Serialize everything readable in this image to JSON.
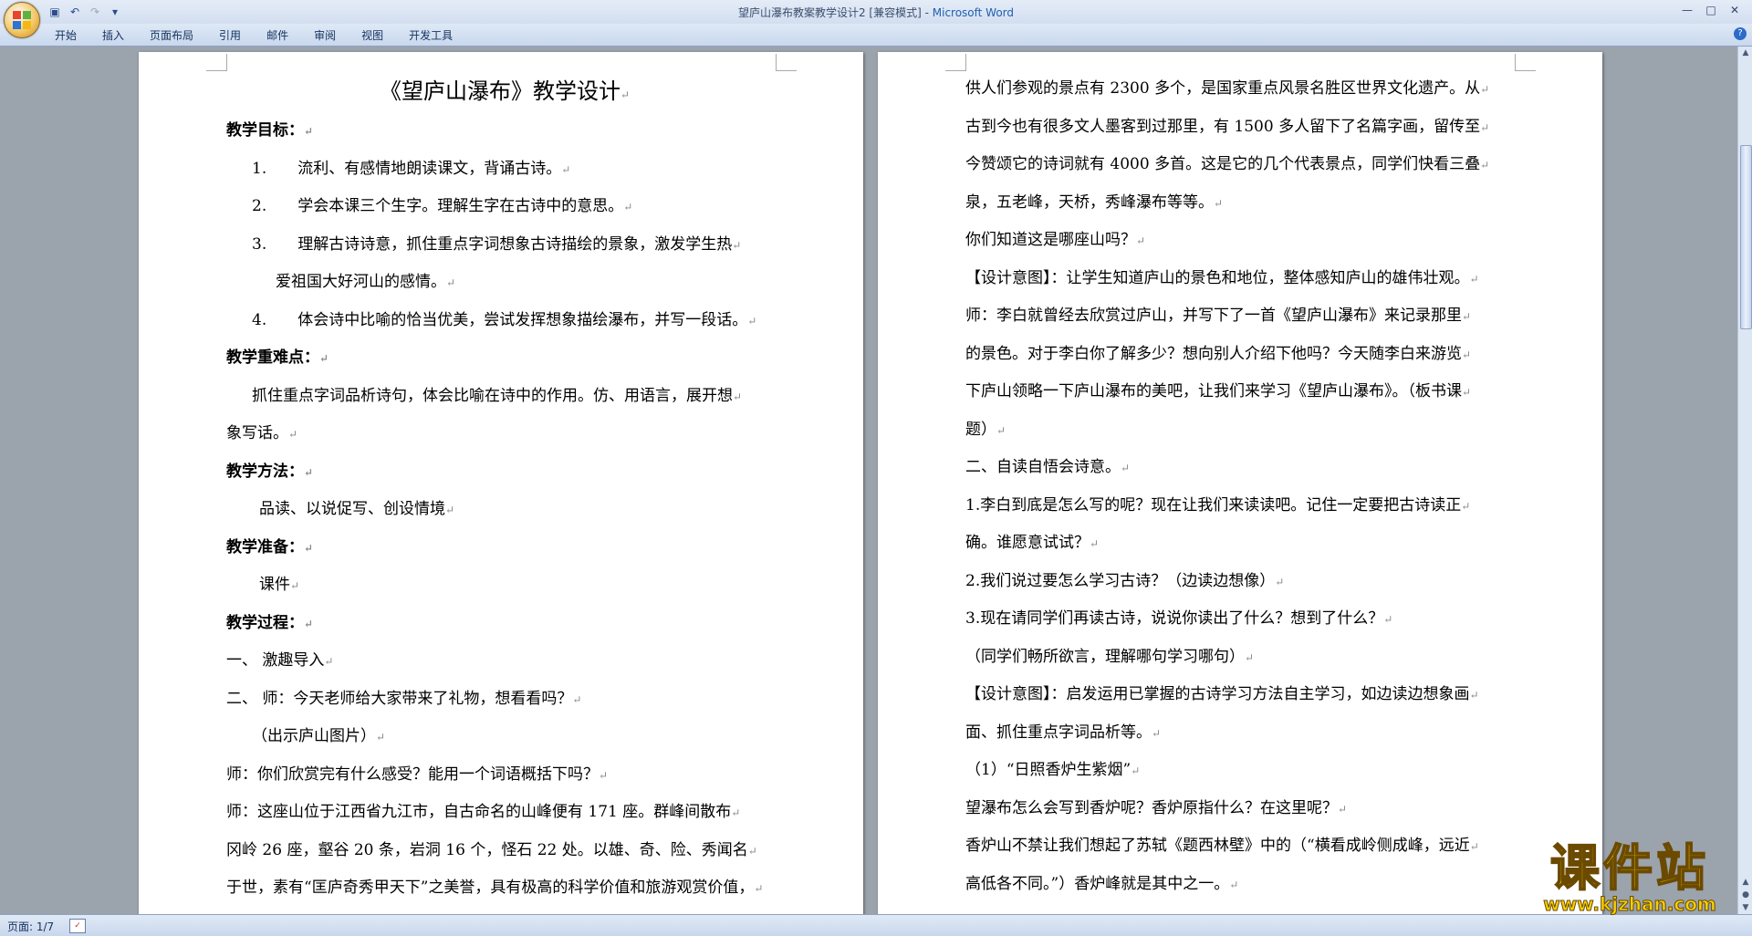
{
  "window": {
    "title_doc": "望庐山瀑布教案教学设计2 [兼容模式]",
    "title_sep": " - ",
    "title_app": "Microsoft Word"
  },
  "quick_access": {
    "icons": [
      "save-icon",
      "undo-icon",
      "redo-icon",
      "customize-icon"
    ]
  },
  "ribbon": {
    "tabs": [
      "开始",
      "插入",
      "页面布局",
      "引用",
      "邮件",
      "审阅",
      "视图",
      "开发工具"
    ]
  },
  "left_page": {
    "title": "《望庐山瀑布》教学设计",
    "lines": [
      {
        "text": "教学目标：",
        "bold": true,
        "indent": 0
      },
      {
        "text": "1.　　流利、有感情地朗读课文，背诵古诗。",
        "bold": false,
        "indent": 28
      },
      {
        "text": "2.　　学会本课三个生字。理解生字在古诗中的意思。",
        "bold": false,
        "indent": 28
      },
      {
        "text": "3.　　理解古诗诗意，抓住重点字词想象古诗描绘的景象，激发学生热",
        "bold": false,
        "indent": 28
      },
      {
        "text": "爱祖国大好河山的感情。",
        "bold": false,
        "indent": 54
      },
      {
        "text": "4.　　体会诗中比喻的恰当优美，尝试发挥想象描绘瀑布，并写一段话。",
        "bold": false,
        "indent": 28
      },
      {
        "text": "教学重难点：",
        "bold": true,
        "indent": 0
      },
      {
        "text": "抓住重点字词品析诗句，体会比喻在诗中的作用。仿、用语言，展开想",
        "bold": false,
        "indent": 28
      },
      {
        "text": "象写话。",
        "bold": false,
        "indent": 0
      },
      {
        "text": "教学方法：",
        "bold": true,
        "indent": 0
      },
      {
        "text": "品读、以说促写、创设情境",
        "bold": false,
        "indent": 36
      },
      {
        "text": "教学准备：",
        "bold": true,
        "indent": 0
      },
      {
        "text": "课件",
        "bold": false,
        "indent": 36
      },
      {
        "text": "教学过程：",
        "bold": true,
        "indent": 0
      },
      {
        "text": "一、 激趣导入",
        "bold": false,
        "indent": 0
      },
      {
        "text": "二、 师：今天老师给大家带来了礼物，想看看吗？",
        "bold": false,
        "indent": 0
      },
      {
        "text": "（出示庐山图片）",
        "bold": false,
        "indent": 28
      },
      {
        "text": "师：你们欣赏完有什么感受？能用一个词语概括下吗？",
        "bold": false,
        "indent": 0
      },
      {
        "text": "师：这座山位于江西省九江市，自古命名的山峰便有 171 座。群峰间散布",
        "bold": false,
        "indent": 0
      },
      {
        "text": "冈岭 26 座，壑谷 20 条，岩洞 16 个，怪石 22 处。以雄、奇、险、秀闻名",
        "bold": false,
        "indent": 0
      },
      {
        "text": "于世，素有“匡庐奇秀甲天下”之美誉，具有极高的科学价值和旅游观赏价值，",
        "bold": false,
        "indent": 0
      }
    ]
  },
  "right_page": {
    "lines": [
      {
        "text": "供人们参观的景点有 2300 多个，是国家重点风景名胜区世界文化遗产。从",
        "bold": false,
        "indent": 0
      },
      {
        "text": "古到今也有很多文人墨客到过那里，有 1500 多人留下了名篇字画，留传至",
        "bold": false,
        "indent": 0
      },
      {
        "text": "今赞颂它的诗词就有 4000 多首。这是它的几个代表景点，同学们快看三叠",
        "bold": false,
        "indent": 0
      },
      {
        "text": "泉，五老峰，天桥，秀峰瀑布等等。",
        "bold": false,
        "indent": 0
      },
      {
        "text": "你们知道这是哪座山吗？",
        "bold": false,
        "indent": 0
      },
      {
        "text": "【设计意图】：让学生知道庐山的景色和地位，整体感知庐山的雄伟壮观。",
        "bold": false,
        "indent": 0
      },
      {
        "text": "师：李白就曾经去欣赏过庐山，并写下了一首《望庐山瀑布》来记录那里",
        "bold": false,
        "indent": 0
      },
      {
        "text": "的景色。对于李白你了解多少？想向别人介绍下他吗？今天随李白来游览",
        "bold": false,
        "indent": 0
      },
      {
        "text": "下庐山领略一下庐山瀑布的美吧，让我们来学习《望庐山瀑布》。（板书课",
        "bold": false,
        "indent": 0
      },
      {
        "text": "题）",
        "bold": false,
        "indent": 0
      },
      {
        "text": "二、自读自悟会诗意。",
        "bold": false,
        "indent": 0
      },
      {
        "text": "1.李白到底是怎么写的呢？现在让我们来读读吧。记住一定要把古诗读正",
        "bold": false,
        "indent": 0
      },
      {
        "text": "确。谁愿意试试？",
        "bold": false,
        "indent": 0
      },
      {
        "text": "2.我们说过要怎么学习古诗？（边读边想像）",
        "bold": false,
        "indent": 0
      },
      {
        "text": "3.现在请同学们再读古诗，说说你读出了什么？想到了什么？",
        "bold": false,
        "indent": 0
      },
      {
        "text": "（同学们畅所欲言，理解哪句学习哪句）",
        "bold": false,
        "indent": 0
      },
      {
        "text": "【设计意图】：启发运用已掌握的古诗学习方法自主学习，如边读边想象画",
        "bold": false,
        "indent": 0
      },
      {
        "text": "面、抓住重点字词品析等。",
        "bold": false,
        "indent": 0
      },
      {
        "text": "（1）“日照香炉生紫烟”",
        "bold": false,
        "indent": 0
      },
      {
        "text": "望瀑布怎么会写到香炉呢？香炉原指什么？在这里呢？",
        "bold": false,
        "indent": 0
      },
      {
        "text": "香炉山不禁让我们想起了苏轼《题西林壁》中的（“横看成岭侧成峰，远近",
        "bold": false,
        "indent": 0
      },
      {
        "text": "高低各不同。”）香炉峰就是其中之一。",
        "bold": false,
        "indent": 0
      }
    ]
  },
  "status_bar": {
    "page_info": "页面: 1/7"
  },
  "watermark": {
    "big": "课件站",
    "url": "www.kjzhan.com"
  },
  "paragraph_mark": "↵",
  "colors": {
    "ribbon_text": "#15325d",
    "app_title_blue": "#1f5fb0",
    "workspace": "#9ba3ad",
    "watermark_yellow": "#f5d000"
  }
}
